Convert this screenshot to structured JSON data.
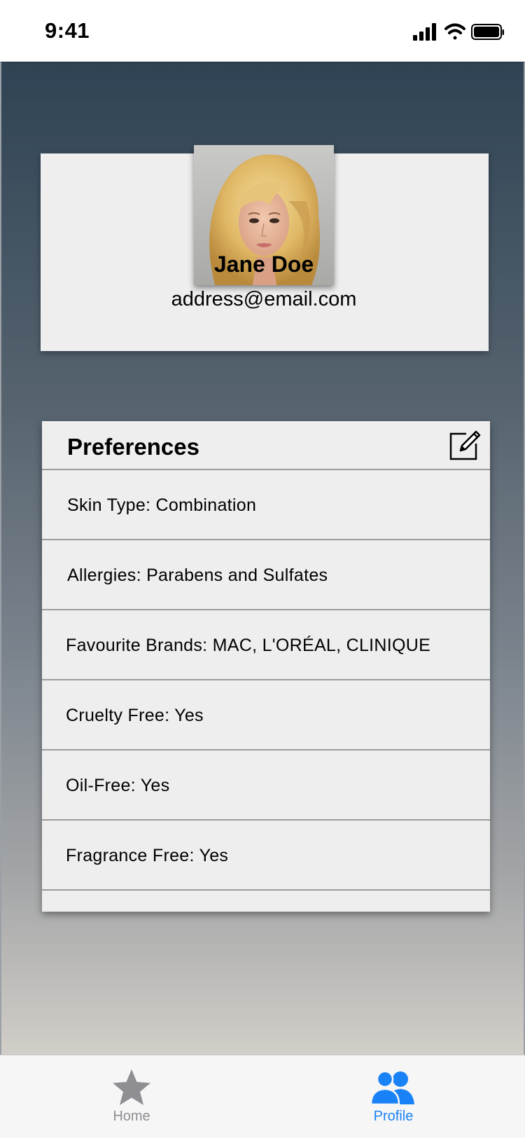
{
  "status_bar": {
    "time": "9:41",
    "icons": [
      "signal-icon",
      "wifi-icon",
      "battery-icon"
    ]
  },
  "profile": {
    "name": "Jane Doe",
    "email": "address@email.com",
    "avatar_icon": "avatar-photo"
  },
  "preferences": {
    "title": "Preferences",
    "edit_icon": "edit-icon",
    "items": [
      {
        "label": "Skin Type: Combination"
      },
      {
        "label": "Allergies: Parabens and Sulfates"
      },
      {
        "label": "Favourite Brands: MAC, L'ORÉAL, CLINIQUE"
      },
      {
        "label": "Cruelty Free: Yes"
      },
      {
        "label": "Oil-Free: Yes"
      },
      {
        "label": "Fragrance Free: Yes"
      }
    ]
  },
  "tab_bar": {
    "tabs": [
      {
        "label": "Home",
        "icon": "star-icon",
        "active": false
      },
      {
        "label": "Profile",
        "icon": "people-icon",
        "active": true
      }
    ],
    "active_color": "#1a82f7",
    "inactive_color": "#8e8e93"
  },
  "colors": {
    "card_background": "#eeeeee",
    "gradient_top": "#2f4354",
    "gradient_bottom": "#d2cec8"
  }
}
